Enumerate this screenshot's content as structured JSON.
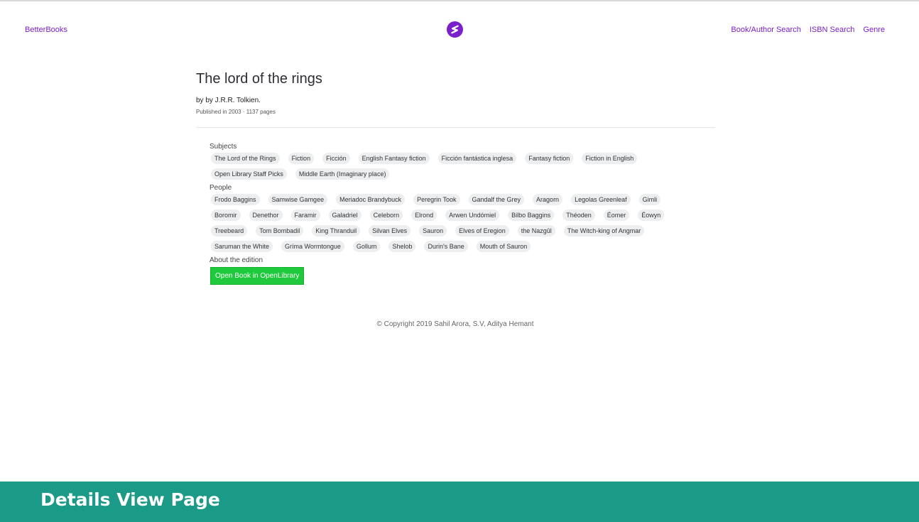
{
  "header": {
    "brand": "BetterBooks",
    "nav": [
      "Book/Author Search",
      "ISBN Search",
      "Genre"
    ],
    "colors": {
      "accent": "#7a1fc9"
    }
  },
  "book": {
    "title": "The lord of the rings",
    "author_line": "by by J.R.R. Tolkien.",
    "meta_line": "Published in 2003 · 1137 pages"
  },
  "subjects": {
    "label": "Subjects",
    "items": [
      "The Lord of the Rings",
      "Fiction",
      "Ficción",
      "English Fantasy fiction",
      "Ficción fantástica inglesa",
      "Fantasy fiction",
      "Fiction in English",
      "Open Library Staff Picks",
      "Middle Earth (Imaginary place)"
    ]
  },
  "people": {
    "label": "People",
    "items": [
      "Frodo Baggins",
      "Samwise Gamgee",
      "Meriadoc Brandybuck",
      "Peregrin Took",
      "Gandalf the Grey",
      "Aragorn",
      "Legolas Greenleaf",
      "Gimli",
      "Boromir",
      "Denethor",
      "Faramir",
      "Galadriel",
      "Celeborn",
      "Elrond",
      "Arwen Undómiel",
      "Bilbo Baggins",
      "Théoden",
      "Éomer",
      "Éowyn",
      "Treebeard",
      "Tom Bombadil",
      "King Thranduil",
      "Silvan Elves",
      "Sauron",
      "Elves of Eregion",
      "the Nazgûl",
      "The Witch-king of Angmar",
      "Saruman the White",
      "Gríma Wormtongue",
      "Gollum",
      "Shelob",
      "Durin's Bane",
      "Mouth of Sauron"
    ]
  },
  "edition": {
    "label": "About the edition",
    "button": "Open Book in OpenLibrary",
    "button_color": "#1fc93c"
  },
  "footer": {
    "copyright": "© Copyright 2019 Sahil Arora, S.V, Aditya Hemant"
  },
  "caption": {
    "text": "Details View Page",
    "color": "#1a9a87"
  }
}
